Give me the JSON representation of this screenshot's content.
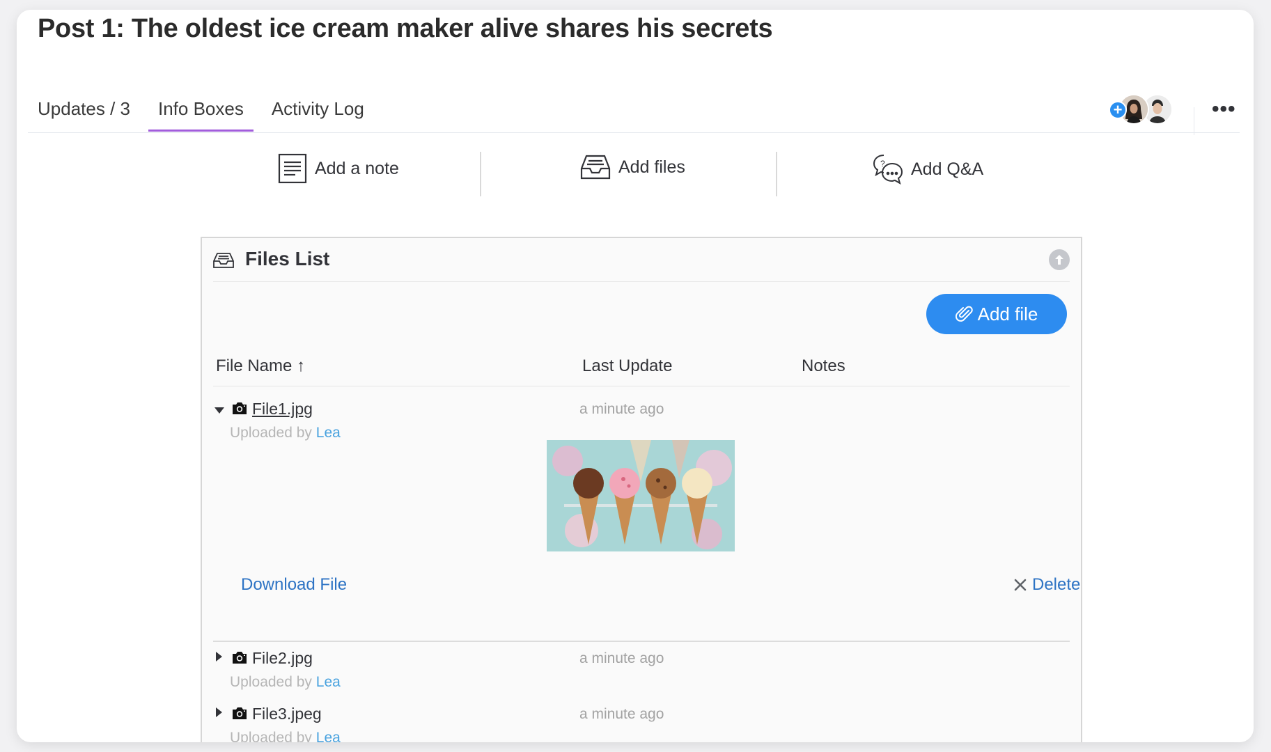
{
  "post": {
    "title": "Post 1: The oldest ice cream maker alive shares his secrets"
  },
  "tabs": [
    {
      "label": "Updates / 3"
    },
    {
      "label": "Info Boxes"
    },
    {
      "label": "Activity Log"
    }
  ],
  "active_tab": "Info Boxes",
  "actions": {
    "note": "Add a note",
    "files": "Add files",
    "qa": "Add Q&A"
  },
  "more_menu": "•••",
  "files_list": {
    "title": "Files List",
    "add_button": "Add file",
    "columns": {
      "name": "File Name",
      "sort_indicator": "↑",
      "updated": "Last Update",
      "notes": "Notes"
    },
    "uploaded_prefix": "Uploaded by",
    "files": [
      {
        "name": "File1.jpg",
        "updated": "a minute ago",
        "uploader": "Lea",
        "expanded": true
      },
      {
        "name": "File2.jpg",
        "updated": "a minute ago",
        "uploader": "Lea",
        "expanded": false
      },
      {
        "name": "File3.jpeg",
        "updated": "a minute ago",
        "uploader": "Lea",
        "expanded": false
      }
    ],
    "download_label": "Download File",
    "delete_label": "Delete"
  },
  "colors": {
    "accent_purple": "#a25ddc",
    "primary_blue": "#2d8cf0",
    "link_blue": "#2d73c4",
    "user_link": "#4aa3df"
  }
}
